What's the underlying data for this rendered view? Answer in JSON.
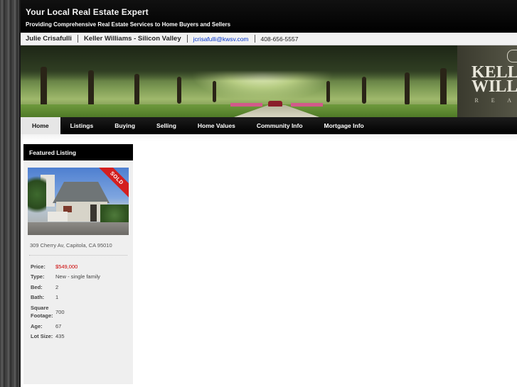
{
  "header": {
    "title": "Your Local Real Estate Expert",
    "tagline": "Providing Comprehensive Real Estate Services to Home Buyers and Sellers"
  },
  "contact": {
    "name": "Julie Crisafulli",
    "company": "Keller Williams - Silicon Valley",
    "email": "jcrisafulli@kwsv.com",
    "phone": "408-656-5557"
  },
  "banner": {
    "logo_line1": "KELL",
    "logo_line2": "WILL",
    "logo_sub": "R E A"
  },
  "nav": {
    "items": [
      {
        "label": "Home",
        "active": true
      },
      {
        "label": "Listings"
      },
      {
        "label": "Buying"
      },
      {
        "label": "Selling"
      },
      {
        "label": "Home Values"
      },
      {
        "label": "Community Info"
      },
      {
        "label": "Mortgage Info"
      }
    ]
  },
  "featured": {
    "title": "Featured Listing",
    "badge": "SOLD",
    "address": "309 Cherry Av, Capitola, CA 95010",
    "details": [
      {
        "label": "Price:",
        "value": "$549,000"
      },
      {
        "label": "Type:",
        "value": "New - single family"
      },
      {
        "label": "Bed:",
        "value": "2"
      },
      {
        "label": "Bath:",
        "value": "1"
      },
      {
        "label": "Square Footage:",
        "value": "700"
      },
      {
        "label": "Age:",
        "value": "67"
      },
      {
        "label": "Lot Size:",
        "value": "435"
      }
    ]
  },
  "colors": {
    "accent_red": "#cc0000",
    "link_blue": "#0033cc",
    "nav_bg": "#000000"
  }
}
